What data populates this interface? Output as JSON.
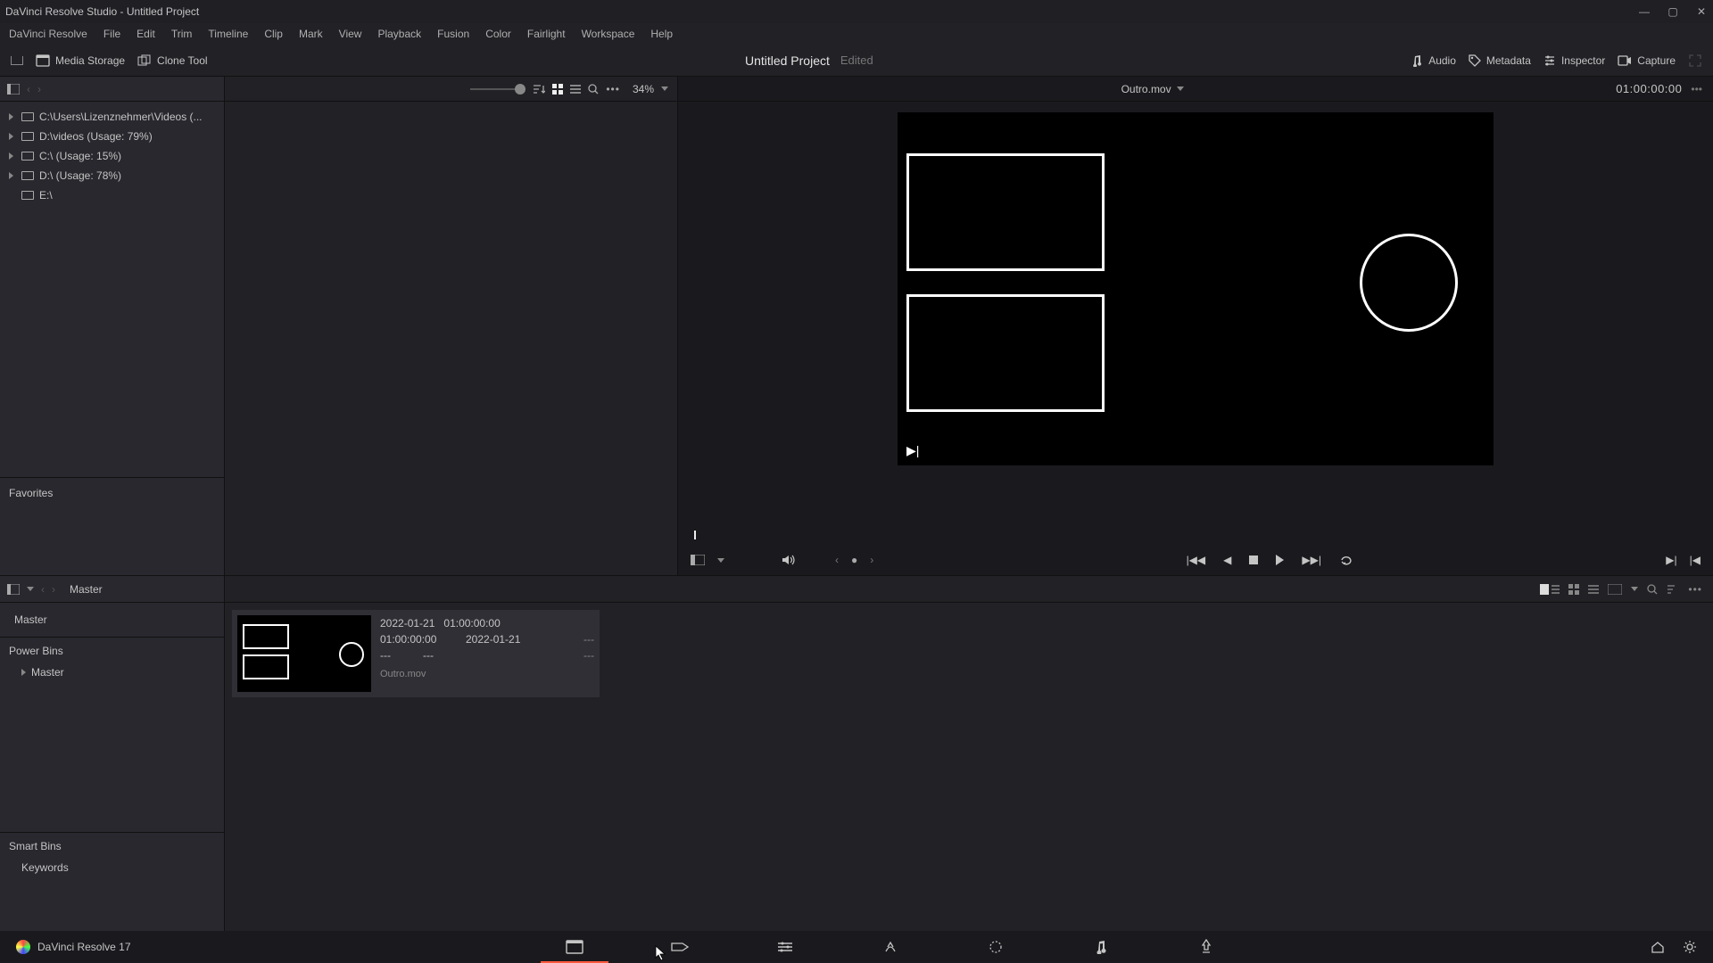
{
  "window": {
    "title": "DaVinci Resolve Studio - Untitled Project"
  },
  "menu": [
    "DaVinci Resolve",
    "File",
    "Edit",
    "Trim",
    "Timeline",
    "Clip",
    "Mark",
    "View",
    "Playback",
    "Fusion",
    "Color",
    "Fairlight",
    "Workspace",
    "Help"
  ],
  "topbar": {
    "media_storage": "Media Storage",
    "clone_tool": "Clone Tool",
    "project_title": "Untitled Project",
    "project_status": "Edited",
    "audio": "Audio",
    "metadata": "Metadata",
    "inspector": "Inspector",
    "capture": "Capture"
  },
  "storage": {
    "items": [
      "C:\\Users\\Lizenznehmer\\Videos (...",
      "D:\\videos (Usage: 79%)",
      "C:\\ (Usage: 15%)",
      "D:\\ (Usage: 78%)",
      "E:\\"
    ],
    "favorites_label": "Favorites"
  },
  "media_toolbar": {
    "zoom": "34%"
  },
  "viewer": {
    "clip_name": "Outro.mov",
    "timecode": "01:00:00:00"
  },
  "bins": {
    "master": "Master",
    "master_item": "Master",
    "power_bins": "Power Bins",
    "power_master": "Master",
    "smart_bins": "Smart Bins",
    "keywords": "Keywords"
  },
  "clip": {
    "date": "2022-01-21",
    "tc": "01:00:00:00",
    "tc_small": "01:00:00:00",
    "date_small": "2022-01-21",
    "dash": "---",
    "filename": "Outro.mov"
  },
  "app": {
    "name": "DaVinci Resolve 17"
  }
}
